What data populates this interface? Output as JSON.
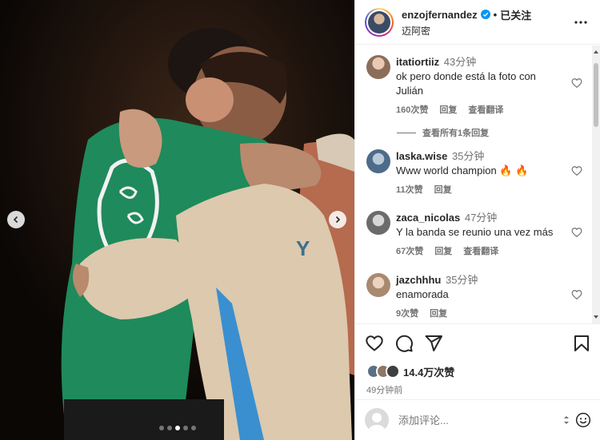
{
  "post": {
    "username": "enzojfernandez",
    "separator": "•",
    "follow_status": "已关注",
    "location": "迈阿密",
    "carousel_dots": 5,
    "carousel_active_index": 2
  },
  "comments": [
    {
      "username": "itatiortiiz",
      "time": "43分钟",
      "text": "ok pero donde está la foto con Julián",
      "likes": "160次赞",
      "reply": "回复",
      "translate": "查看翻译",
      "avatar_color": "#8c6d5a"
    },
    {
      "username": "laska.wise",
      "time": "35分钟",
      "text": "Www world champion 🔥 🔥",
      "likes": "11次赞",
      "reply": "回复",
      "avatar_color": "#4d6b8a"
    },
    {
      "username": "zaca_nicolas",
      "time": "47分钟",
      "text": "Y la banda se reunio una vez más",
      "likes": "67次赞",
      "reply": "回复",
      "translate": "查看翻译",
      "avatar_color": "#6b6b6b"
    },
    {
      "username": "jazchhhu",
      "time": "35分钟",
      "text": "enamorada",
      "likes": "9次赞",
      "reply": "回复",
      "avatar_color": "#a88a70"
    }
  ],
  "view_replies": "查看所有1条回复",
  "footer": {
    "likes": "14.4万次赞",
    "post_time": "49分钟前",
    "add_comment_placeholder": "添加评论..."
  },
  "colors": {
    "text_primary": "#262626",
    "text_secondary": "#737373",
    "verified_blue": "#0095f6",
    "border": "#efefef"
  }
}
